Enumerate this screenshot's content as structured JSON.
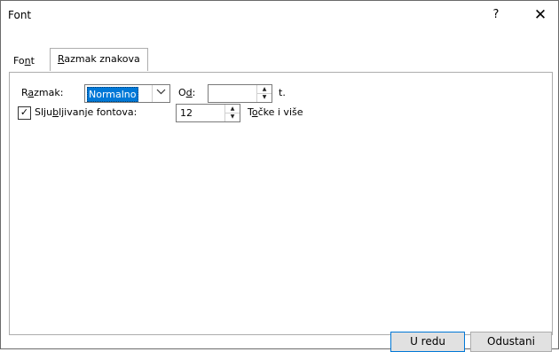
{
  "window": {
    "title": "Font",
    "help_symbol": "?",
    "close_symbol": "✕"
  },
  "tabs": [
    {
      "pre": "Fo",
      "key": "n",
      "post": "t"
    },
    {
      "pre": "",
      "key": "R",
      "post": "azmak znakova"
    }
  ],
  "spacing": {
    "label_pre": "R",
    "label_key": "a",
    "label_post": "zmak:",
    "value": "Normalno",
    "by_label_pre": "O",
    "by_label_key": "d",
    "by_label_post": ":",
    "by_value": "",
    "unit": "t."
  },
  "kerning": {
    "checked": true,
    "check_glyph": "✓",
    "label_pre": "Slju",
    "label_key": "b",
    "label_post": "ljivanje fontova:",
    "value": "12",
    "unit_pre": "T",
    "unit_key": "o",
    "unit_post": "čke i više"
  },
  "buttons": {
    "ok": "U redu",
    "cancel": "Odustani"
  },
  "icons": {
    "dropdown": "chevron-down-icon",
    "spin_up": "spin-up-icon",
    "spin_down": "spin-down-icon"
  }
}
